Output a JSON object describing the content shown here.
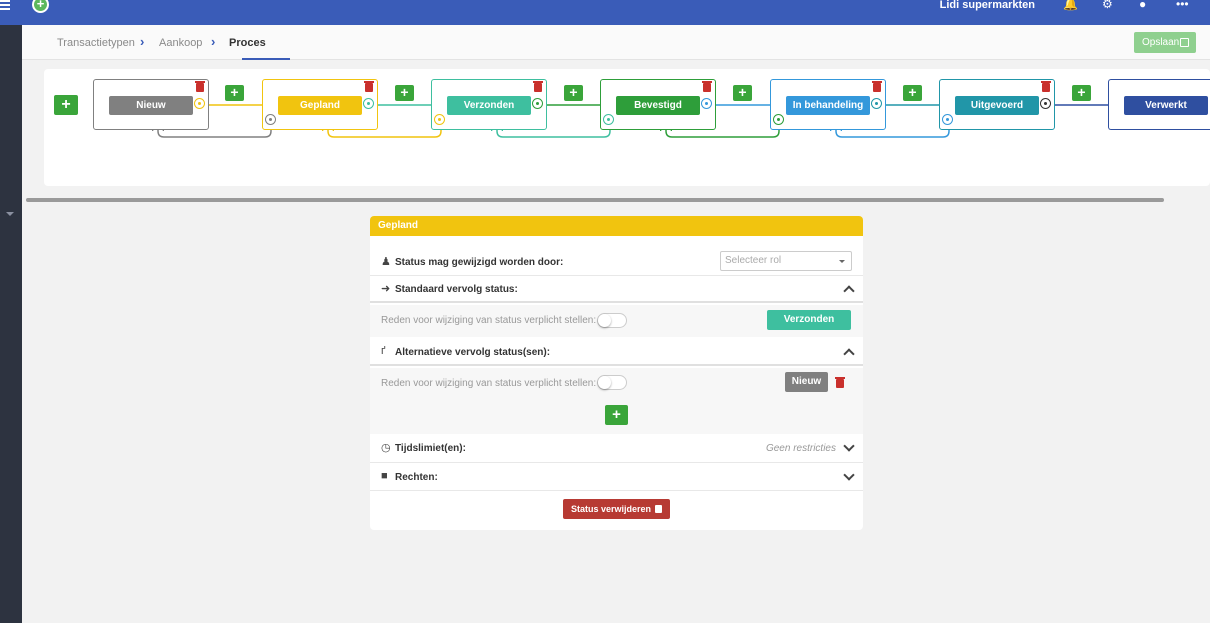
{
  "app": {
    "company": "Lidi supermarkten",
    "top_icons": [
      "bell-icon",
      "gear-icon",
      "user-icon",
      "more-icon"
    ]
  },
  "breadcrumb": {
    "items": [
      "Transactietypen",
      "Aankoop",
      "Proces"
    ],
    "save_label": "Opslaan"
  },
  "flow": {
    "statuses": [
      {
        "label": "Nieuw",
        "color": "#808080"
      },
      {
        "label": "Gepland",
        "color": "#f1c40f"
      },
      {
        "label": "Verzonden",
        "color": "#3ebf9f"
      },
      {
        "label": "Bevestigd",
        "color": "#2e9e3a"
      },
      {
        "label": "In behandeling",
        "color": "#3498db"
      },
      {
        "label": "Uitgevoerd",
        "color": "#2196a8"
      },
      {
        "label": "Verwerkt",
        "color": "#2f4fa0"
      }
    ]
  },
  "detail": {
    "title": "Gepland",
    "header_color": "#f1c40f",
    "role_label": "Status mag gewijzigd worden door:",
    "role_placeholder": "Selecteer rol",
    "default_next_label": "Standaard vervolg status:",
    "reason_label": "Reden voor wijziging van status verplicht stellen:",
    "default_next_status": "Verzonden",
    "alt_next_label": "Alternatieve vervolg status(sen):",
    "alt_next_status": "Nieuw",
    "time_limit_label": "Tijdslimiet(en):",
    "time_limit_value": "Geen restricties",
    "rights_label": "Rechten:",
    "delete_label": "Status verwijderen"
  }
}
